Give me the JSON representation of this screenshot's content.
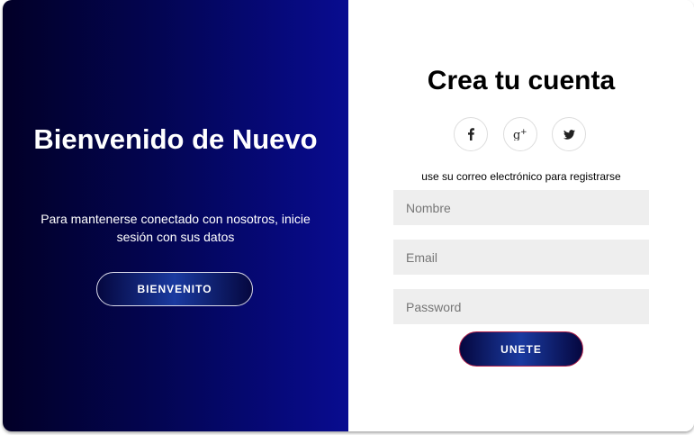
{
  "overlay": {
    "title": "Bienvenido de Nuevo",
    "text": "Para mantenerse conectado con nosotros, inicie sesión con sus datos",
    "button_label": "BIENVENITO"
  },
  "signup": {
    "title": "Crea tu cuenta",
    "social": [
      {
        "name": "facebook-icon",
        "glyph": "f"
      },
      {
        "name": "google-plus-icon",
        "glyph": "g+"
      },
      {
        "name": "twitter-icon",
        "glyph": "bird"
      }
    ],
    "hint": "use su correo electrónico para registrarse",
    "fields": {
      "name_placeholder": "Nombre",
      "email_placeholder": "Email",
      "password_placeholder": "Password"
    },
    "submit_label": "UNETE"
  },
  "colors": {
    "overlay_gradient_start": "#020027",
    "overlay_gradient_end": "#090c90",
    "button_accent": "#1a3aa0",
    "submit_border": "#b0204a",
    "input_background": "#eeeeee"
  }
}
